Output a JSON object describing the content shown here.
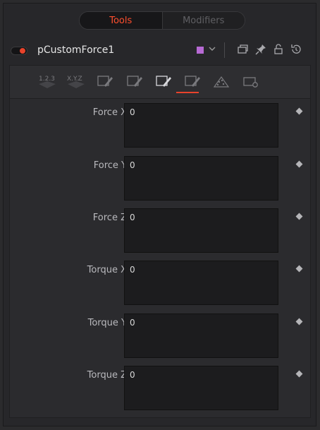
{
  "tabs": [
    {
      "label": "Tools",
      "active": true
    },
    {
      "label": "Modifiers",
      "active": false
    }
  ],
  "header": {
    "node_name": "pCustomForce1",
    "color_swatch": "#b76ad4",
    "icons": [
      "color-swatch-icon",
      "chevron-down-icon",
      "window-icon",
      "pin-icon",
      "lock-icon",
      "reset-icon"
    ]
  },
  "toolbar": {
    "buttons": [
      "numeric-123-icon",
      "xyz-icon",
      "edit-page-1-icon",
      "edit-page-2-icon",
      "edit-page-3-icon",
      "edit-page-4-icon",
      "particle-style-icon",
      "settings-icon"
    ],
    "active_index": 4,
    "active_color": "#e8432b"
  },
  "params": [
    {
      "label": "Force X",
      "value": "0"
    },
    {
      "label": "Force Y",
      "value": "0"
    },
    {
      "label": "Force Z",
      "value": "0"
    },
    {
      "label": "Torque X",
      "value": "0"
    },
    {
      "label": "Torque Y",
      "value": "0"
    },
    {
      "label": "Torque Z",
      "value": "0"
    }
  ]
}
